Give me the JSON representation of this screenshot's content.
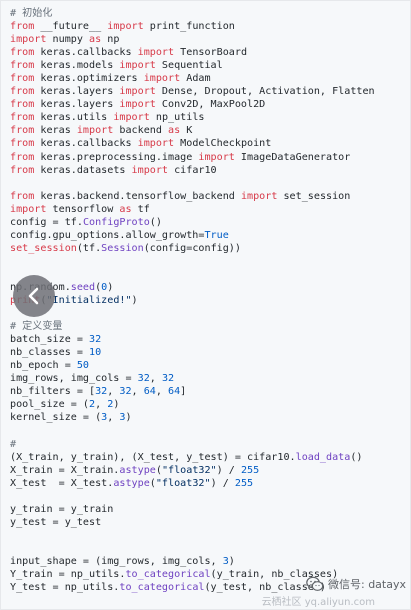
{
  "code": {
    "lines": [
      [
        {
          "t": "# 初始化",
          "c": "cm"
        }
      ],
      [
        {
          "t": "from",
          "c": "kw"
        },
        {
          "t": " __future__ "
        },
        {
          "t": "import",
          "c": "kw"
        },
        {
          "t": " print_function"
        }
      ],
      [
        {
          "t": "import",
          "c": "kw"
        },
        {
          "t": " numpy "
        },
        {
          "t": "as",
          "c": "kw"
        },
        {
          "t": " np"
        }
      ],
      [
        {
          "t": "from",
          "c": "kw"
        },
        {
          "t": " keras.callbacks "
        },
        {
          "t": "import",
          "c": "kw"
        },
        {
          "t": " TensorBoard"
        }
      ],
      [
        {
          "t": "from",
          "c": "kw"
        },
        {
          "t": " keras.models "
        },
        {
          "t": "import",
          "c": "kw"
        },
        {
          "t": " Sequential"
        }
      ],
      [
        {
          "t": "from",
          "c": "kw"
        },
        {
          "t": " keras.optimizers "
        },
        {
          "t": "import",
          "c": "kw"
        },
        {
          "t": " Adam"
        }
      ],
      [
        {
          "t": "from",
          "c": "kw"
        },
        {
          "t": " keras.layers "
        },
        {
          "t": "import",
          "c": "kw"
        },
        {
          "t": " Dense, Dropout, Activation, Flatten"
        }
      ],
      [
        {
          "t": "from",
          "c": "kw"
        },
        {
          "t": " keras.layers "
        },
        {
          "t": "import",
          "c": "kw"
        },
        {
          "t": " Conv2D, MaxPool2D"
        }
      ],
      [
        {
          "t": "from",
          "c": "kw"
        },
        {
          "t": " keras.utils "
        },
        {
          "t": "import",
          "c": "kw"
        },
        {
          "t": " np_utils"
        }
      ],
      [
        {
          "t": "from",
          "c": "kw"
        },
        {
          "t": " keras "
        },
        {
          "t": "import",
          "c": "kw"
        },
        {
          "t": " backend "
        },
        {
          "t": "as",
          "c": "kw"
        },
        {
          "t": " K"
        }
      ],
      [
        {
          "t": "from",
          "c": "kw"
        },
        {
          "t": " keras.callbacks "
        },
        {
          "t": "import",
          "c": "kw"
        },
        {
          "t": " ModelCheckpoint"
        }
      ],
      [
        {
          "t": "from",
          "c": "kw"
        },
        {
          "t": " keras.preprocessing.image "
        },
        {
          "t": "import",
          "c": "kw"
        },
        {
          "t": " ImageDataGenerator"
        }
      ],
      [
        {
          "t": "from",
          "c": "kw"
        },
        {
          "t": " keras.datasets "
        },
        {
          "t": "import",
          "c": "kw"
        },
        {
          "t": " cifar10"
        }
      ],
      [],
      [
        {
          "t": "from",
          "c": "kw"
        },
        {
          "t": " keras.backend.tensorflow_backend "
        },
        {
          "t": "import",
          "c": "kw"
        },
        {
          "t": " set_session"
        }
      ],
      [
        {
          "t": "import",
          "c": "kw"
        },
        {
          "t": " tensorflow "
        },
        {
          "t": "as",
          "c": "kw"
        },
        {
          "t": " tf"
        }
      ],
      [
        {
          "t": "config = tf."
        },
        {
          "t": "ConfigProto",
          "c": "fn"
        },
        {
          "t": "()"
        }
      ],
      [
        {
          "t": "config.gpu_options.allow_growth="
        },
        {
          "t": "True",
          "c": "num"
        }
      ],
      [
        {
          "t": "set_session",
          "c": "kw"
        },
        {
          "t": "(tf."
        },
        {
          "t": "Session",
          "c": "fn"
        },
        {
          "t": "(config=config))"
        }
      ],
      [],
      [],
      [
        {
          "t": "np.random."
        },
        {
          "t": "seed",
          "c": "fn"
        },
        {
          "t": "("
        },
        {
          "t": "0",
          "c": "num"
        },
        {
          "t": ")"
        }
      ],
      [
        {
          "t": "print",
          "c": "kw"
        },
        {
          "t": "("
        },
        {
          "t": "\"Initialized!\"",
          "c": "str"
        },
        {
          "t": ")"
        }
      ],
      [],
      [
        {
          "t": "# 定义变量",
          "c": "cm"
        }
      ],
      [
        {
          "t": "batch_size = "
        },
        {
          "t": "32",
          "c": "num"
        }
      ],
      [
        {
          "t": "nb_classes = "
        },
        {
          "t": "10",
          "c": "num"
        }
      ],
      [
        {
          "t": "nb_epoch = "
        },
        {
          "t": "50",
          "c": "num"
        }
      ],
      [
        {
          "t": "img_rows, img_cols = "
        },
        {
          "t": "32",
          "c": "num"
        },
        {
          "t": ", "
        },
        {
          "t": "32",
          "c": "num"
        }
      ],
      [
        {
          "t": "nb_filters = ["
        },
        {
          "t": "32",
          "c": "num"
        },
        {
          "t": ", "
        },
        {
          "t": "32",
          "c": "num"
        },
        {
          "t": ", "
        },
        {
          "t": "64",
          "c": "num"
        },
        {
          "t": ", "
        },
        {
          "t": "64",
          "c": "num"
        },
        {
          "t": "]"
        }
      ],
      [
        {
          "t": "pool_size = ("
        },
        {
          "t": "2",
          "c": "num"
        },
        {
          "t": ", "
        },
        {
          "t": "2",
          "c": "num"
        },
        {
          "t": ")"
        }
      ],
      [
        {
          "t": "kernel_size = ("
        },
        {
          "t": "3",
          "c": "num"
        },
        {
          "t": ", "
        },
        {
          "t": "3",
          "c": "num"
        },
        {
          "t": ")"
        }
      ],
      [],
      [
        {
          "t": "#",
          "c": "cm"
        }
      ],
      [
        {
          "t": "(X_train, y_train), (X_test, y_test) = cifar10."
        },
        {
          "t": "load_data",
          "c": "fn"
        },
        {
          "t": "()"
        }
      ],
      [
        {
          "t": "X_train = X_train."
        },
        {
          "t": "astype",
          "c": "fn"
        },
        {
          "t": "("
        },
        {
          "t": "\"float32\"",
          "c": "str"
        },
        {
          "t": ") / "
        },
        {
          "t": "255",
          "c": "num"
        }
      ],
      [
        {
          "t": "X_test  = X_test."
        },
        {
          "t": "astype",
          "c": "fn"
        },
        {
          "t": "("
        },
        {
          "t": "\"float32\"",
          "c": "str"
        },
        {
          "t": ") / "
        },
        {
          "t": "255",
          "c": "num"
        }
      ],
      [],
      [
        {
          "t": "y_train = y_train"
        }
      ],
      [
        {
          "t": "y_test = y_test"
        }
      ],
      [],
      [],
      [
        {
          "t": "input_shape = (img_rows, img_cols, "
        },
        {
          "t": "3",
          "c": "num"
        },
        {
          "t": ")"
        }
      ],
      [
        {
          "t": "Y_train = np_utils."
        },
        {
          "t": "to_categorical",
          "c": "fn"
        },
        {
          "t": "(y_train, nb_classes)"
        }
      ],
      [
        {
          "t": "Y_test = np_utils."
        },
        {
          "t": "to_categorical",
          "c": "fn"
        },
        {
          "t": "(y_test, nb_classes)"
        }
      ]
    ]
  },
  "overlay": {
    "back_icon": "chevron-left-icon"
  },
  "watermark": {
    "icon": "wechat-icon",
    "text": "微信号: datayx",
    "sub_text": "云栖社区 yq.aliyun.com"
  }
}
